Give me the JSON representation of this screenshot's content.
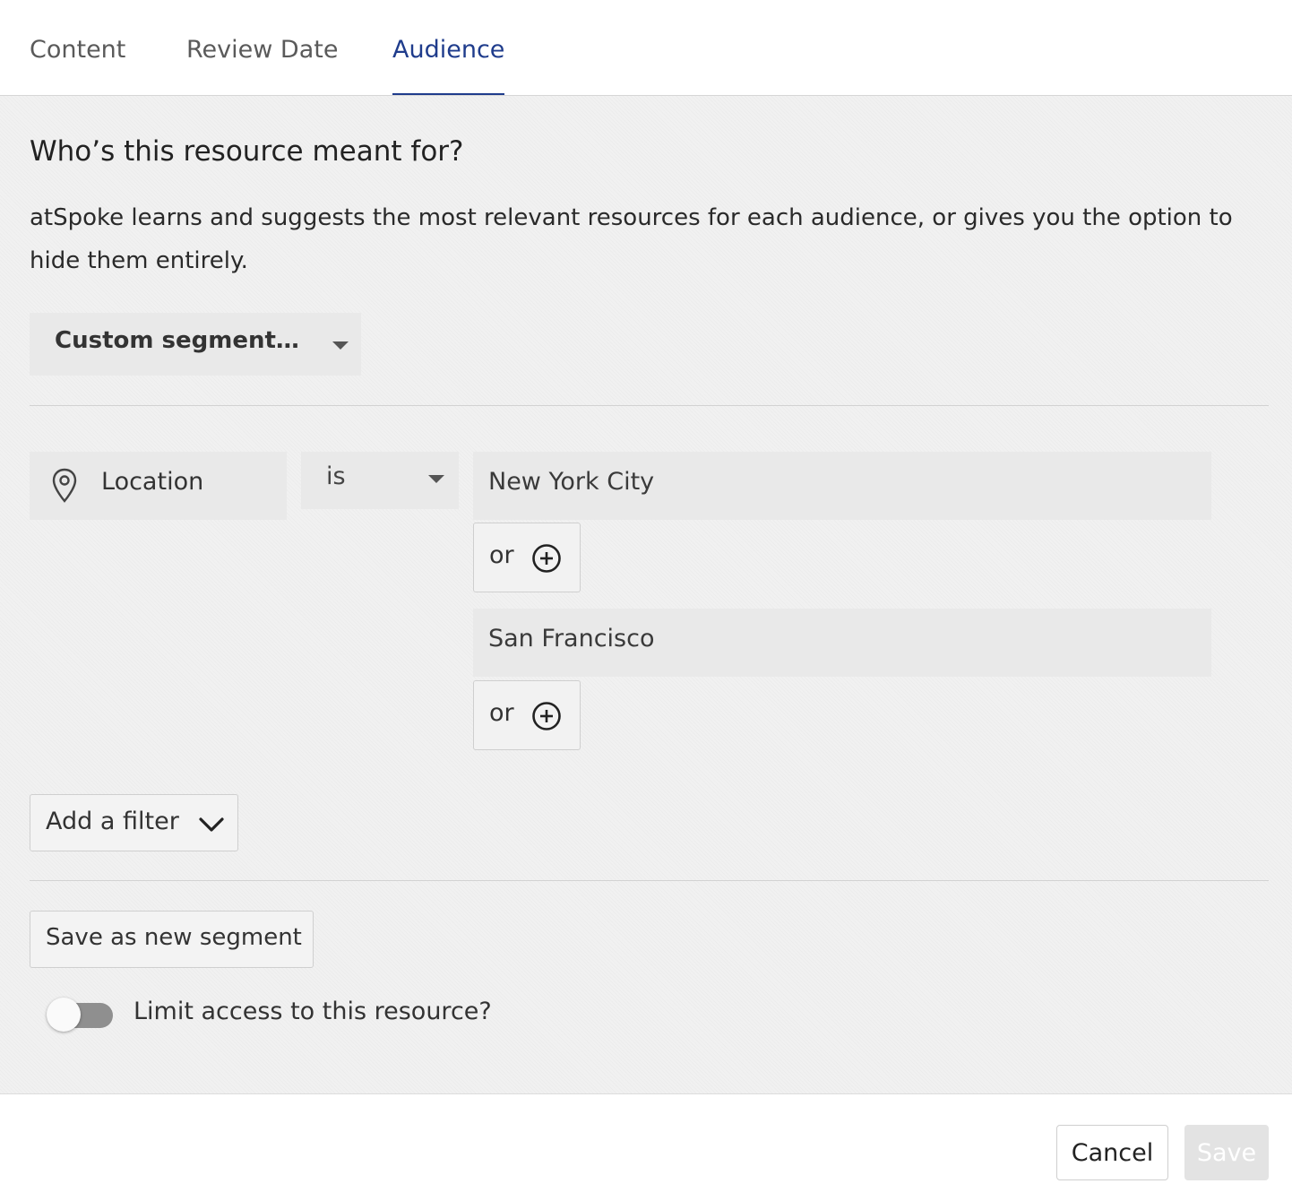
{
  "tabs": [
    {
      "label": "Content",
      "active": false
    },
    {
      "label": "Review Date",
      "active": false
    },
    {
      "label": "Audience",
      "active": true
    }
  ],
  "audience": {
    "heading": "Who’s this resource meant for?",
    "description": "atSpoke learns and suggests the most relevant resources for each audience, or gives you the option to hide them entirely.",
    "segment_select": {
      "value": "Custom segment…",
      "icon": "caret-down-icon"
    },
    "filter": {
      "field": {
        "label": "Location",
        "icon": "location-pin-icon"
      },
      "operator": {
        "value": "is",
        "icon": "caret-down-icon"
      },
      "values": [
        "New York City",
        "San Francisco"
      ],
      "or_label": "or",
      "or_icon": "plus-circle-icon"
    },
    "add_filter": {
      "label": "Add a filter",
      "icon": "chevron-down-icon"
    },
    "save_segment_label": "Save as new segment",
    "limit_access": {
      "label": "Limit access to this resource?",
      "enabled": false
    }
  },
  "footer": {
    "cancel_label": "Cancel",
    "save_label": "Save",
    "save_disabled": true
  },
  "colors": {
    "accent": "#1f3c8c",
    "panel_bg": "#f1f1f1",
    "field_bg": "#e9e9e9"
  }
}
